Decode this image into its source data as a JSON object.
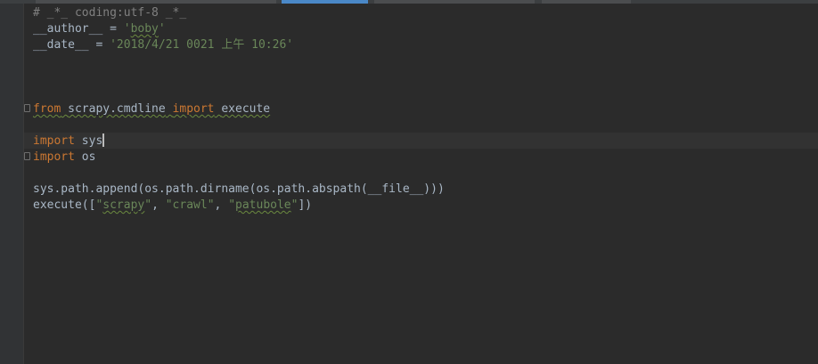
{
  "editor": {
    "lines": [
      {
        "parts": [
          {
            "t": "# _*_ coding:utf-8 _*_",
            "c": "comment"
          }
        ]
      },
      {
        "parts": [
          {
            "t": "__author__ = ",
            "c": "id"
          },
          {
            "t": "'",
            "c": "str"
          },
          {
            "t": "boby",
            "c": "str",
            "sq": true
          },
          {
            "t": "'",
            "c": "str"
          }
        ]
      },
      {
        "parts": [
          {
            "t": "__date__ = ",
            "c": "id"
          },
          {
            "t": "'2018/4/21 0021 上午 10:26'",
            "c": "str"
          }
        ]
      },
      {
        "parts": []
      },
      {
        "parts": []
      },
      {
        "parts": []
      },
      {
        "parts": [
          {
            "t": "from",
            "c": "kw",
            "sq": true
          },
          {
            "t": " ",
            "c": "id",
            "sq": true
          },
          {
            "t": "scrapy.cmdline",
            "c": "id",
            "sq": true
          },
          {
            "t": " ",
            "c": "id",
            "sq": true
          },
          {
            "t": "import",
            "c": "kw",
            "sq": true
          },
          {
            "t": " ",
            "c": "id",
            "sq": true
          },
          {
            "t": "execute",
            "c": "id",
            "sq": true
          }
        ]
      },
      {
        "parts": []
      },
      {
        "parts": [
          {
            "t": "import",
            "c": "kw"
          },
          {
            "t": " ",
            "c": "id"
          },
          {
            "t": "sys",
            "c": "id"
          }
        ],
        "caret": true
      },
      {
        "parts": [
          {
            "t": "import",
            "c": "kw"
          },
          {
            "t": " ",
            "c": "id"
          },
          {
            "t": "os",
            "c": "id"
          }
        ]
      },
      {
        "parts": []
      },
      {
        "parts": [
          {
            "t": "sys.path.append(os.path.dirname(os.path.abspath(__file__)))",
            "c": "id"
          }
        ]
      },
      {
        "parts": [
          {
            "t": "execute([",
            "c": "id"
          },
          {
            "t": "\"",
            "c": "str"
          },
          {
            "t": "scrapy",
            "c": "str",
            "sq": true
          },
          {
            "t": "\"",
            "c": "str"
          },
          {
            "t": ", ",
            "c": "id"
          },
          {
            "t": "\"crawl\"",
            "c": "str"
          },
          {
            "t": ", ",
            "c": "id"
          },
          {
            "t": "\"",
            "c": "str"
          },
          {
            "t": "patubole",
            "c": "str",
            "sq": true
          },
          {
            "t": "\"",
            "c": "str"
          },
          {
            "t": "])",
            "c": "id"
          }
        ]
      }
    ]
  }
}
